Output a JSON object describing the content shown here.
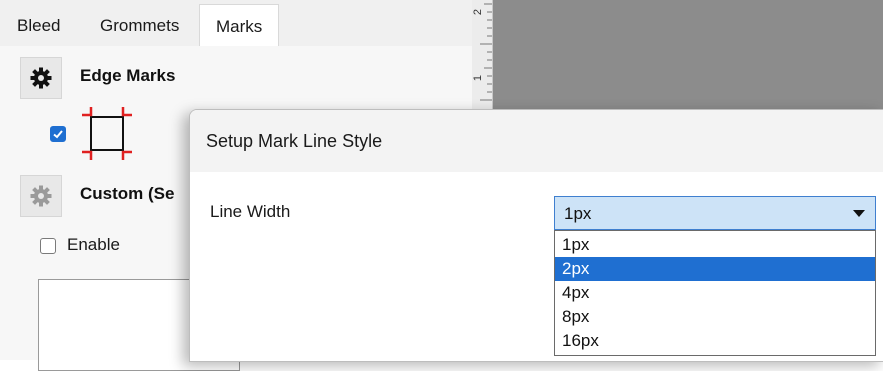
{
  "tabs": [
    {
      "label": "Bleed",
      "active": false
    },
    {
      "label": "Grommets",
      "active": false
    },
    {
      "label": "Marks",
      "active": true
    }
  ],
  "edge_marks": {
    "title": "Edge Marks",
    "checked": true
  },
  "custom_section": {
    "title": "Custom (Se"
  },
  "enable": {
    "label": "Enable",
    "checked": false
  },
  "ruler": {
    "labels": [
      "2",
      "1"
    ]
  },
  "dialog": {
    "title": "Setup Mark Line Style",
    "line_width_label": "Line Width",
    "selected_value": "1px",
    "options": [
      "1px",
      "2px",
      "4px",
      "8px",
      "16px"
    ],
    "highlighted_option": "2px"
  },
  "colors": {
    "accent": "#1f6fd1",
    "select_bg": "#cde3f7",
    "canvas_gray": "#8c8c8c",
    "mark_red": "#e02020"
  }
}
